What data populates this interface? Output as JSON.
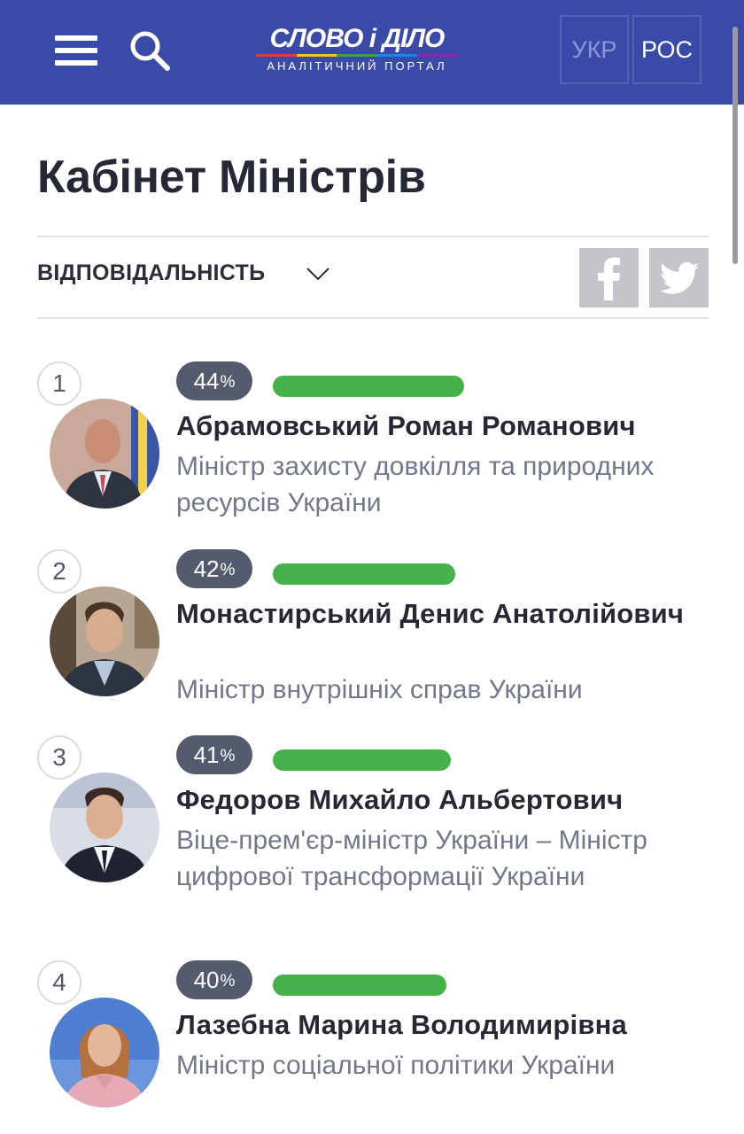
{
  "header": {
    "logo_title": "СЛОВО і ДІЛО",
    "logo_subtitle": "АНАЛІТИЧНИЙ ПОРТАЛ",
    "lang_ukr": "УКР",
    "lang_ros": "РОС",
    "background": "#3a4aa8"
  },
  "page": {
    "title": "Кабінет Міністрів",
    "filter_label": "ВІДПОВІДАЛЬНІСТЬ"
  },
  "share": {
    "facebook_icon": "facebook-icon",
    "twitter_icon": "twitter-icon"
  },
  "ratings": [
    {
      "rank": "1",
      "percent": "44",
      "percent_sign": "%",
      "value": 44,
      "name": "Абрамовський Роман Романович",
      "role": "Міністр захисту довкілля та природних ресурсів України"
    },
    {
      "rank": "2",
      "percent": "42",
      "percent_sign": "%",
      "value": 42,
      "name": "Монастирський Денис Анатолійович",
      "role": "Міністр внутрішніх справ України"
    },
    {
      "rank": "3",
      "percent": "41",
      "percent_sign": "%",
      "value": 41,
      "name": "Федоров Михайло Альбертович",
      "role": "Віце-прем'єр-міністр України – Міністр цифрової трансформації України"
    },
    {
      "rank": "4",
      "percent": "40",
      "percent_sign": "%",
      "value": 40,
      "name": "Лазебна Марина Володимирівна",
      "role": "Міністр соціальної політики України"
    }
  ],
  "colors": {
    "bar": "#46b04b",
    "badge": "#545b6e"
  }
}
